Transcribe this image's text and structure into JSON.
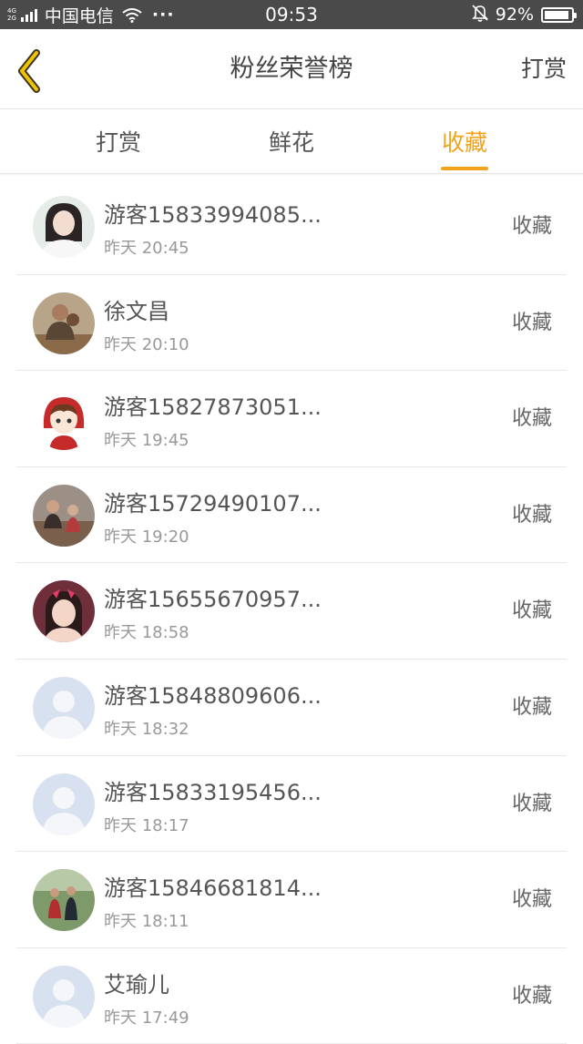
{
  "status_bar": {
    "network_top": "4G",
    "network_bottom": "2G",
    "carrier": "中国电信",
    "more": "···",
    "time": "09:53",
    "battery_text": "92%",
    "battery_level": 0.92
  },
  "nav": {
    "title": "粉丝荣誉榜",
    "action": "打赏",
    "back_icon": "chevron-left-icon"
  },
  "tabs": [
    {
      "label": "打赏",
      "active": false
    },
    {
      "label": "鲜花",
      "active": false
    },
    {
      "label": "收藏",
      "active": true
    }
  ],
  "colors": {
    "accent": "#f2a31b",
    "status_bar": "#4a4a4a",
    "text_primary": "#555555",
    "text_secondary": "#999999"
  },
  "list": [
    {
      "name": "游客15833994085...",
      "time": "昨天 20:45",
      "action": "收藏",
      "avatar": "photo-girl"
    },
    {
      "name": "徐文昌",
      "time": "昨天 20:10",
      "action": "收藏",
      "avatar": "photo-man"
    },
    {
      "name": "游客15827873051...",
      "time": "昨天 19:45",
      "action": "收藏",
      "avatar": "cartoon-red-hood"
    },
    {
      "name": "游客15729490107...",
      "time": "昨天 19:20",
      "action": "收藏",
      "avatar": "photo-family"
    },
    {
      "name": "游客15655670957...",
      "time": "昨天 18:58",
      "action": "收藏",
      "avatar": "photo-woman-bow"
    },
    {
      "name": "游客15848809606...",
      "time": "昨天 18:32",
      "action": "收藏",
      "avatar": "default-user"
    },
    {
      "name": "游客15833195456...",
      "time": "昨天 18:17",
      "action": "收藏",
      "avatar": "default-user"
    },
    {
      "name": "游客15846681814...",
      "time": "昨天 18:11",
      "action": "收藏",
      "avatar": "photo-couple"
    },
    {
      "name": "艾瑜儿",
      "time": "昨天 17:49",
      "action": "收藏",
      "avatar": "default-user"
    }
  ]
}
